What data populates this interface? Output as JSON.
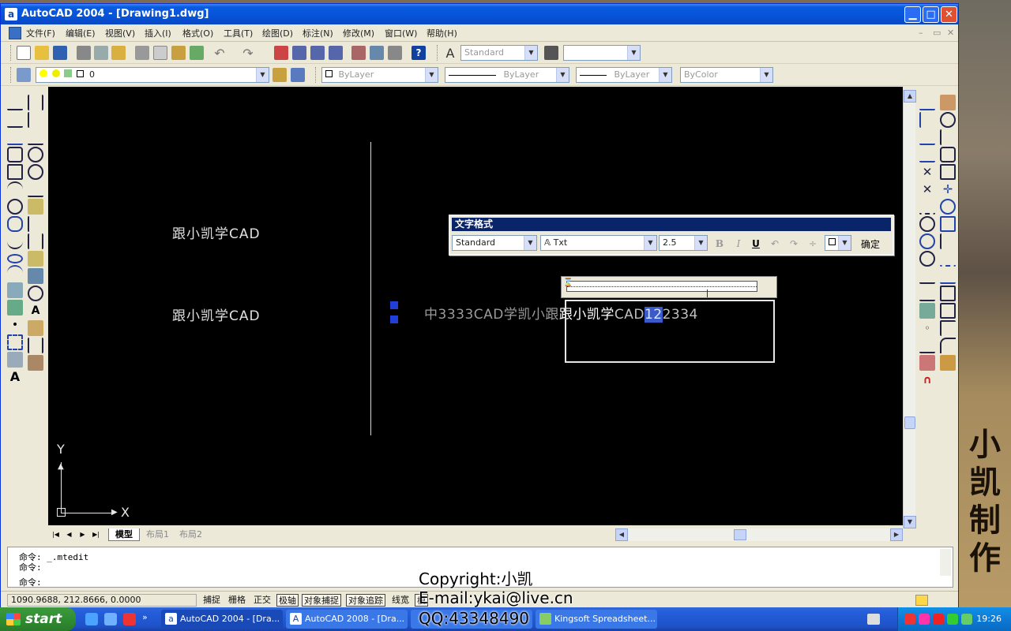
{
  "decor": {
    "calligraphy": [
      "小",
      "凯",
      "制",
      "作"
    ]
  },
  "window": {
    "title": "AutoCAD 2004 - [Drawing1.dwg]",
    "app_icon": "a",
    "controls": [
      "minimize",
      "maximize",
      "close"
    ]
  },
  "menu": [
    "文件(F)",
    "编辑(E)",
    "视图(V)",
    "插入(I)",
    "格式(O)",
    "工具(T)",
    "绘图(D)",
    "标注(N)",
    "修改(M)",
    "窗口(W)",
    "帮助(H)"
  ],
  "toolbar1": {
    "text_style": "Standard",
    "dim_style": ""
  },
  "toolbar2": {
    "layer": "0",
    "color": "ByLayer",
    "linetype": "ByLayer",
    "lineweight": "ByLayer",
    "plotstyle": "ByColor"
  },
  "canvas": {
    "text1": "跟小凯学CAD",
    "text2": "跟小凯学CAD",
    "mtext_garbled": "中3333CAD学凯小跟",
    "mtext_white": "跟小凯学",
    "mtext_grey": "CAD",
    "mtext_sel": "12",
    "mtext_tail": "2334",
    "ucs_x": "X",
    "ucs_y": "Y"
  },
  "layout_tabs": [
    "模型",
    "布局1",
    "布局2"
  ],
  "text_format": {
    "caption": "文字格式",
    "style": "Standard",
    "font": "Txt",
    "height": "2.5",
    "bold": "B",
    "italic": "I",
    "underline": "U",
    "ok": "确定"
  },
  "command": {
    "line1": "命令: _.mtedit",
    "line2": "命令:",
    "line3": "命令:"
  },
  "status": {
    "coords": "1090.9688, 212.8666, 0.0000",
    "buttons": [
      "捕捉",
      "栅格",
      "正交",
      "极轴",
      "对象捕捉",
      "对象追踪",
      "线宽",
      "模"
    ]
  },
  "overlay": {
    "copyright": "Copyright:小凯",
    "email": "E-mail:ykai@live.cn",
    "qq": "QQ:43348490"
  },
  "taskbar": {
    "start": "start",
    "tasks": [
      "AutoCAD 2004 - [Dra...",
      "AutoCAD 2008 - [Dra...",
      "",
      "Kingsoft Spreadsheet..."
    ],
    "clock": "19:26"
  },
  "colors": {
    "title_blue": "#0653d8",
    "canvas_bg": "#000000",
    "grip_blue": "#1f3fd8",
    "selection": "#3a5acb",
    "taskbar": "#245edb",
    "start_green": "#2f8a2f"
  }
}
